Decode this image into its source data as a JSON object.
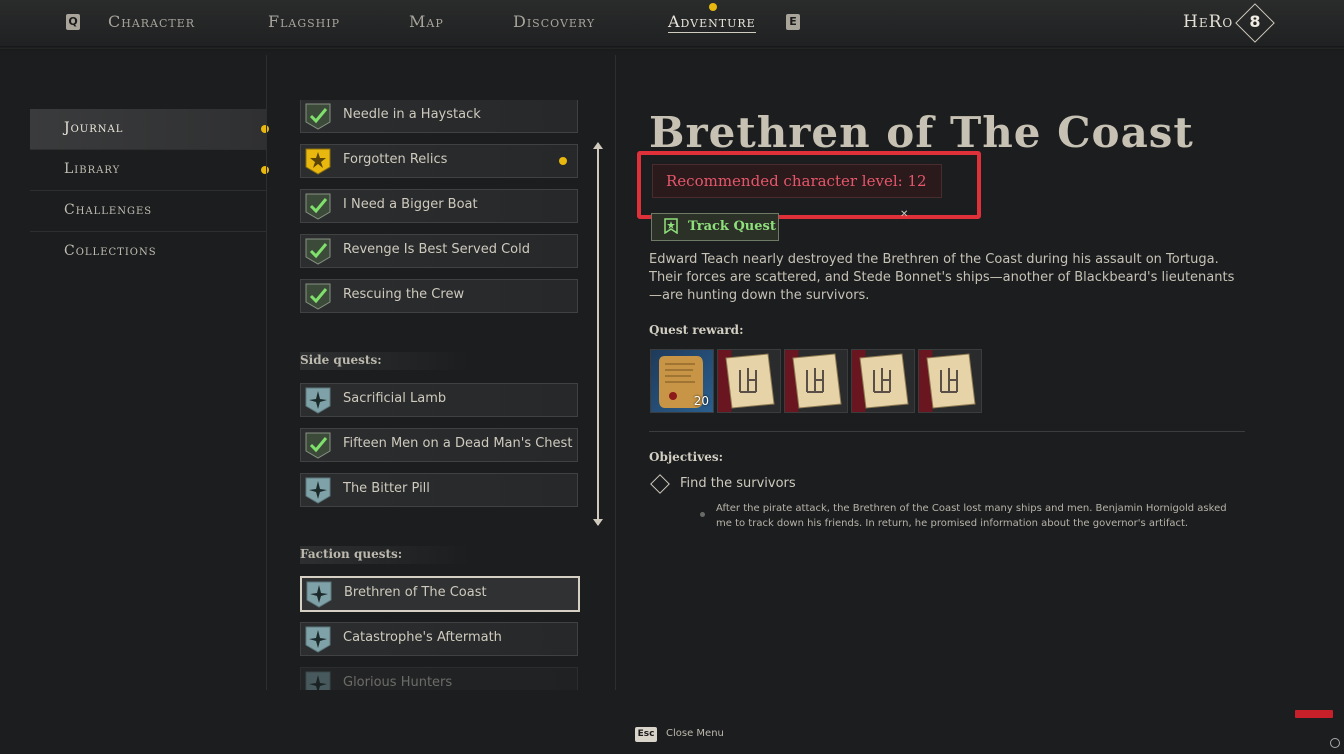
{
  "topnav": {
    "left_key": "Q",
    "right_key": "E",
    "items": [
      "Character",
      "Flagship",
      "Map",
      "Discovery",
      "Adventure"
    ],
    "active": "Adventure",
    "player_name": "HeRo",
    "player_level": "8"
  },
  "leftmenu": {
    "items": [
      {
        "label": "Journal",
        "active": true,
        "dot": true
      },
      {
        "label": "Library",
        "active": false,
        "dot": true
      },
      {
        "label": "Challenges",
        "active": false,
        "dot": false
      },
      {
        "label": "Collections",
        "active": false,
        "dot": false
      }
    ]
  },
  "quests": {
    "main": [
      {
        "label": "Needle in a Haystack",
        "status": "completed"
      },
      {
        "label": "Forgotten Relics",
        "status": "new",
        "dot": true
      },
      {
        "label": "I Need a Bigger Boat",
        "status": "completed"
      },
      {
        "label": "Revenge Is Best Served Cold",
        "status": "completed"
      },
      {
        "label": "Rescuing the Crew",
        "status": "completed"
      }
    ],
    "side_title": "Side quests:",
    "side": [
      {
        "label": "Sacrificial Lamb",
        "status": "active"
      },
      {
        "label": "Fifteen Men on a Dead Man's Chest",
        "status": "completed"
      },
      {
        "label": "The Bitter Pill",
        "status": "active"
      }
    ],
    "faction_title": "Faction quests:",
    "faction": [
      {
        "label": "Brethren of The Coast",
        "status": "active",
        "selected": true
      },
      {
        "label": "Catastrophe's Aftermath",
        "status": "active"
      },
      {
        "label": "Glorious Hunters",
        "status": "active"
      }
    ]
  },
  "detail": {
    "title": "Brethren of The Coast",
    "recommended": "Recommended character level: 12",
    "track_label": "Track Quest",
    "description": "Edward Teach nearly destroyed the Brethren of the Coast during his assault on Tortuga. Their forces are scattered, and Stede Bonnet's ships—another of Blackbeard's lieutenants—are hunting down the survivors.",
    "reward_label": "Quest reward:",
    "rewards": [
      {
        "icon": "scroll-icon",
        "qty": "20"
      },
      {
        "icon": "blueprint-icon",
        "qty": ""
      },
      {
        "icon": "blueprint-icon",
        "qty": ""
      },
      {
        "icon": "blueprint-icon",
        "qty": ""
      },
      {
        "icon": "blueprint-icon",
        "qty": ""
      }
    ],
    "objectives_label": "Objectives:",
    "objective": "Find the survivors",
    "objective_detail": "After the pirate attack, the Brethren of the Coast lost many ships and men. Benjamin Hornigold asked me to track down his friends. In return, he promised information about the governor's artifact."
  },
  "footer": {
    "esc_key": "Esc",
    "close_label": "Close Menu"
  },
  "colors": {
    "accent_gold": "#e8b80f",
    "highlight_red": "#e0303a",
    "track_green": "#8fe07c"
  }
}
